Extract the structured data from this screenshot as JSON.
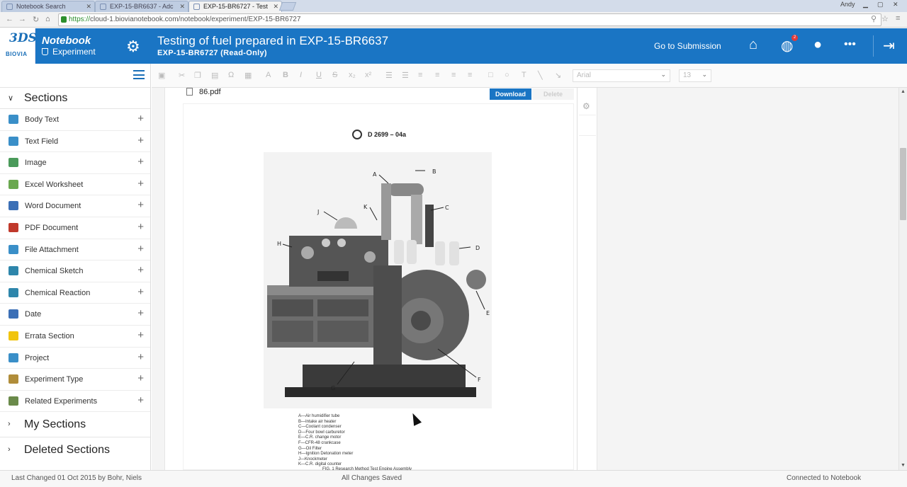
{
  "browser": {
    "tabs": [
      {
        "label": "Notebook Search",
        "active": false
      },
      {
        "label": "EXP-15-BR6637 - Adc",
        "active": false
      },
      {
        "label": "EXP-15-BR6727 - Test",
        "active": true
      }
    ],
    "user_label": "Andy",
    "url_scheme": "https://",
    "url_rest": "cloud-1.biovianotebook.com/notebook/experiment/EXP-15-BR6727"
  },
  "header": {
    "logo_mark": "3DS",
    "logo_text": "BIOVIA",
    "app_name": "Notebook",
    "module": "Experiment",
    "title": "Testing of fuel prepared in EXP-15-BR6637",
    "subtitle": "EXP-15-BR6727 (Read-Only)",
    "goto_submission": "Go to Submission",
    "notification_count": "2",
    "icons": [
      "gear-icon",
      "home-icon",
      "globe-icon",
      "user-icon",
      "more-icon",
      "logout-icon"
    ],
    "accent_color": "#1a75c4"
  },
  "sidebar": {
    "sections_label": "Sections",
    "items": [
      {
        "label": "Body Text",
        "icon": "T",
        "color": "#3a8fc8"
      },
      {
        "label": "Text Field",
        "icon": "T",
        "color": "#3a8fc8"
      },
      {
        "label": "Image",
        "icon": "img",
        "color": "#4a9a5a"
      },
      {
        "label": "Excel Worksheet",
        "icon": "XLS",
        "color": "#6aa84f"
      },
      {
        "label": "Word Document",
        "icon": "DOC",
        "color": "#3b6fb6"
      },
      {
        "label": "PDF Document",
        "icon": "PDF",
        "color": "#c0392b"
      },
      {
        "label": "File Attachment",
        "icon": "att",
        "color": "#3a8fc8"
      },
      {
        "label": "Chemical Sketch",
        "icon": "sk",
        "color": "#2e86ab"
      },
      {
        "label": "Chemical Reaction",
        "icon": "rx",
        "color": "#2e86ab"
      },
      {
        "label": "Date",
        "icon": "31",
        "color": "#3b6fb6"
      },
      {
        "label": "Errata Section",
        "icon": "!",
        "color": "#f1c40f"
      },
      {
        "label": "Project",
        "icon": "prj",
        "color": "#3a8fc8"
      },
      {
        "label": "Experiment Type",
        "icon": "tag",
        "color": "#b08d3a"
      },
      {
        "label": "Related Experiments",
        "icon": "rel",
        "color": "#6a8a4a"
      }
    ],
    "my_sections": "My Sections",
    "deleted_sections": "Deleted Sections"
  },
  "toolbar": {
    "font": "Arial",
    "size": "13"
  },
  "document": {
    "filename": "86.pdf",
    "download_label": "Download",
    "delete_label": "Delete",
    "standard": "D 2699 – 04a",
    "callouts": [
      "A",
      "B",
      "C",
      "D",
      "E",
      "F",
      "G",
      "H",
      "J",
      "K"
    ],
    "legend": [
      "A—Air humidifier tube",
      "B—Intake air heater",
      "C—Coolant condenser",
      "D—Four bowl carburetor",
      "E—C.R. change motor",
      "F—CFR-48 crankcase",
      "G—Oil Filter",
      "H—Ignition Detonation meter",
      "J—Knockmeter",
      "K—C.R. digital counter"
    ],
    "caption": "FIG. 1 Research Method Test Engine Assembly"
  },
  "status": {
    "last_changed": "Last Changed 01 Oct 2015 by Bohr, Niels",
    "saved": "All Changes Saved",
    "connection": "Connected to Notebook"
  }
}
